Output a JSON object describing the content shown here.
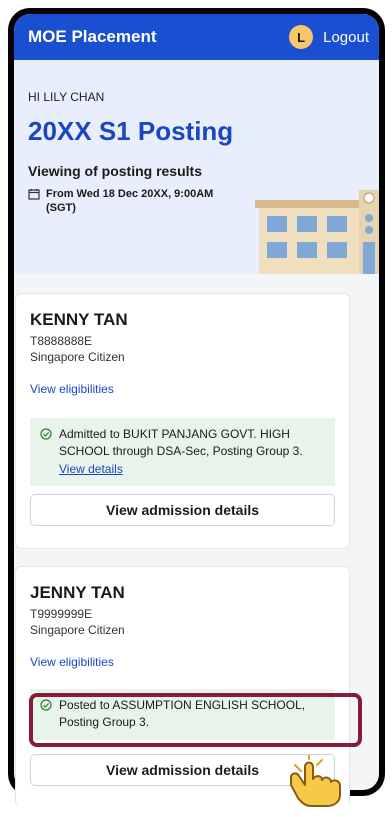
{
  "header": {
    "app_title": "MOE Placement",
    "avatar_initial": "L",
    "logout_label": "Logout"
  },
  "hero": {
    "greeting": "HI LILY CHAN",
    "title": "20XX S1 Posting",
    "subtitle": "Viewing of posting results",
    "date_text": "From Wed 18 Dec 20XX, 9:00AM (SGT)"
  },
  "students": [
    {
      "name": "KENNY TAN",
      "id": "T8888888E",
      "citizenship": "Singapore Citizen",
      "eligibility_link": "View eligibilities",
      "result_text": "Admitted to BUKIT PANJANG GOVT. HIGH SCHOOL through DSA-Sec, Posting Group 3.",
      "details_link": "View details",
      "button_label": "View admission details"
    },
    {
      "name": "JENNY TAN",
      "id": "T9999999E",
      "citizenship": "Singapore Citizen",
      "eligibility_link": "View eligibilities",
      "result_text": "Posted to ASSUMPTION ENGLISH SCHOOL, Posting Group 3.",
      "button_label": "View admission details"
    }
  ],
  "colors": {
    "primary": "#1a4fd1",
    "accent_title": "#1a46c4",
    "success_bg": "#e8f4ea",
    "highlight": "#8a1c3a"
  }
}
